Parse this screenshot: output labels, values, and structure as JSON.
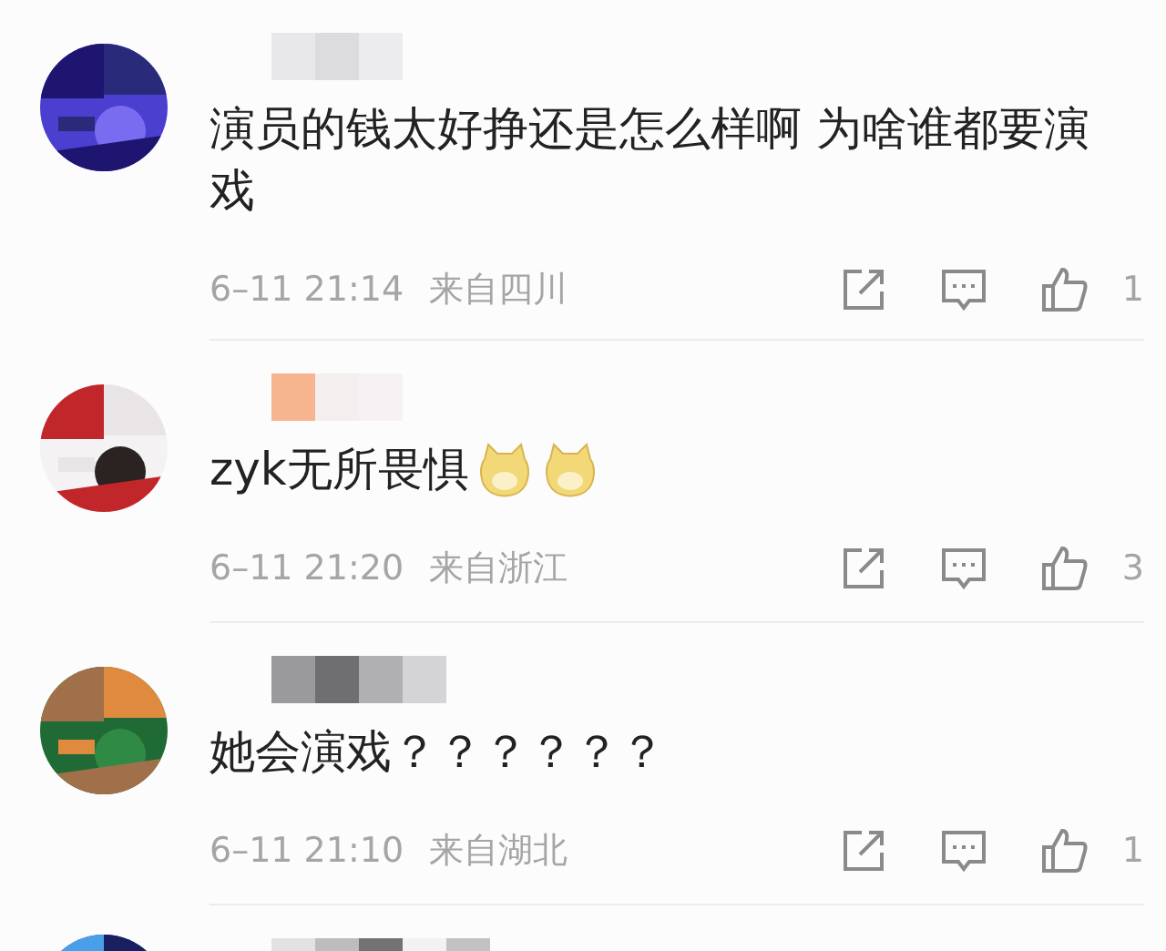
{
  "comments": [
    {
      "kind": "full",
      "text": "演员的钱太好挣还是怎么样啊 为啥谁都要演戏",
      "time": "6–11 21:14",
      "location": "来自四川",
      "likes": "1"
    },
    {
      "kind": "full",
      "text": "zyk无所畏惧",
      "emojis": [
        {
          "kind": "dog"
        },
        {
          "kind": "dog"
        }
      ],
      "time": "6–11 21:20",
      "location": "来自浙江",
      "likes": "3"
    },
    {
      "kind": "full",
      "text": "她会演戏？？？？？？",
      "time": "6–11 21:10",
      "location": "来自湖北",
      "likes": "1"
    },
    {
      "kind": "cut"
    }
  ]
}
